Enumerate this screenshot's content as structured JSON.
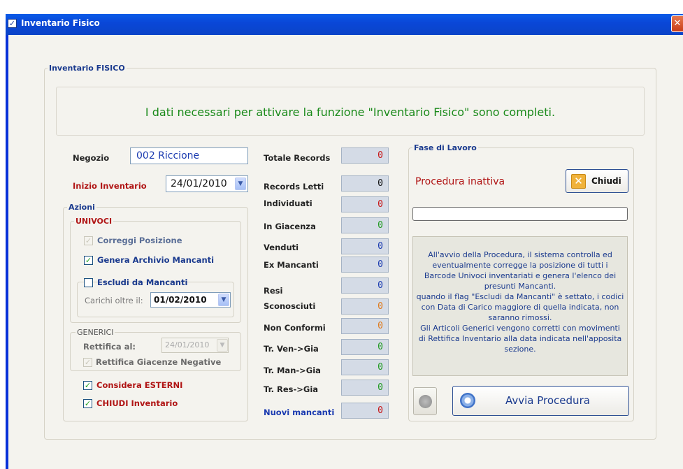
{
  "window": {
    "title": "Inventario Fisico",
    "close_glyph": "✕"
  },
  "group_title": "Inventario FISICO",
  "banner": "I dati necessari per attivare la funzione \"Inventario Fisico\" sono completi.",
  "negozio": {
    "label": "Negozio",
    "value": "002  Riccione"
  },
  "inizio": {
    "label": "Inizio Inventario",
    "value": "24/01/2010"
  },
  "azioni": {
    "title": "Azioni",
    "univoci": {
      "title": "UNIVOCI",
      "correggi": {
        "label": "Correggi Posizione",
        "checked": true,
        "enabled": false
      },
      "genera": {
        "label": "Genera Archivio Mancanti",
        "checked": true
      },
      "escludi": {
        "label": "Escludi da Mancanti",
        "checked": false
      },
      "carichi_label": "Carichi oltre il:",
      "carichi_value": "01/02/2010"
    },
    "generici": {
      "title": "GENERICI",
      "rettifica_label": "Rettifica al:",
      "rettifica_value": "24/01/2010",
      "rettifica_neg": {
        "label": "Rettifica Giacenze Negative",
        "checked": true,
        "enabled": false
      }
    },
    "considera": {
      "label": "Considera ESTERNI",
      "checked": true
    },
    "chiudi": {
      "label": "CHIUDI Inventario",
      "checked": true
    }
  },
  "counters": [
    {
      "label": "Totale Records",
      "value": "0",
      "color": "#c81414"
    },
    {
      "label": "Records Letti",
      "value": "0",
      "color": "#111111"
    },
    {
      "label": "Individuati",
      "value": "0",
      "color": "#c81414"
    },
    {
      "label": "In Giacenza",
      "value": "0",
      "color": "#1f9a1f"
    },
    {
      "label": "Venduti",
      "value": "0",
      "color": "#1a3ab0"
    },
    {
      "label": "Ex Mancanti",
      "value": "0",
      "color": "#1a3ab0"
    },
    {
      "label": "Resi",
      "value": "0",
      "color": "#1a3ab0"
    },
    {
      "label": "Sconosciuti",
      "value": "0",
      "color": "#e07a1a"
    },
    {
      "label": "Non Conformi",
      "value": "0",
      "color": "#e07a1a"
    },
    {
      "label": "Tr. Ven->Gia",
      "value": "0",
      "color": "#1f9a1f"
    },
    {
      "label": "Tr. Man->Gia",
      "value": "0",
      "color": "#1f9a1f"
    },
    {
      "label": "Tr. Res->Gia",
      "value": "0",
      "color": "#1f9a1f"
    },
    {
      "label": "Nuovi mancanti",
      "value": "0",
      "color": "#c81414"
    }
  ],
  "fase": {
    "title": "Fase di Lavoro",
    "status": "Procedura inattiva",
    "chiudi_button": "Chiudi",
    "progress_value": 0,
    "info": "All'avvio della Procedura, il sistema controlla ed eventualmente corregge la posizione di tutti i Barcode Univoci inventariati e genera l'elenco dei presunti Mancanti.\nquando il flag \"Escludi da Mancanti\" è settato, i codici con Data di Carico maggiore di quella indicata, non saranno rimossi.\nGli Articoli Generici vengono corretti con movimenti di Rettifica Inventario alla data indicata nell'apposita sezione.",
    "avvia_button": "Avvia Procedura"
  },
  "colors": {
    "title_bar": "#0a47d8",
    "banner_text": "#1a8a1a",
    "label_blue": "#1a3a8e",
    "label_red": "#b01414"
  }
}
